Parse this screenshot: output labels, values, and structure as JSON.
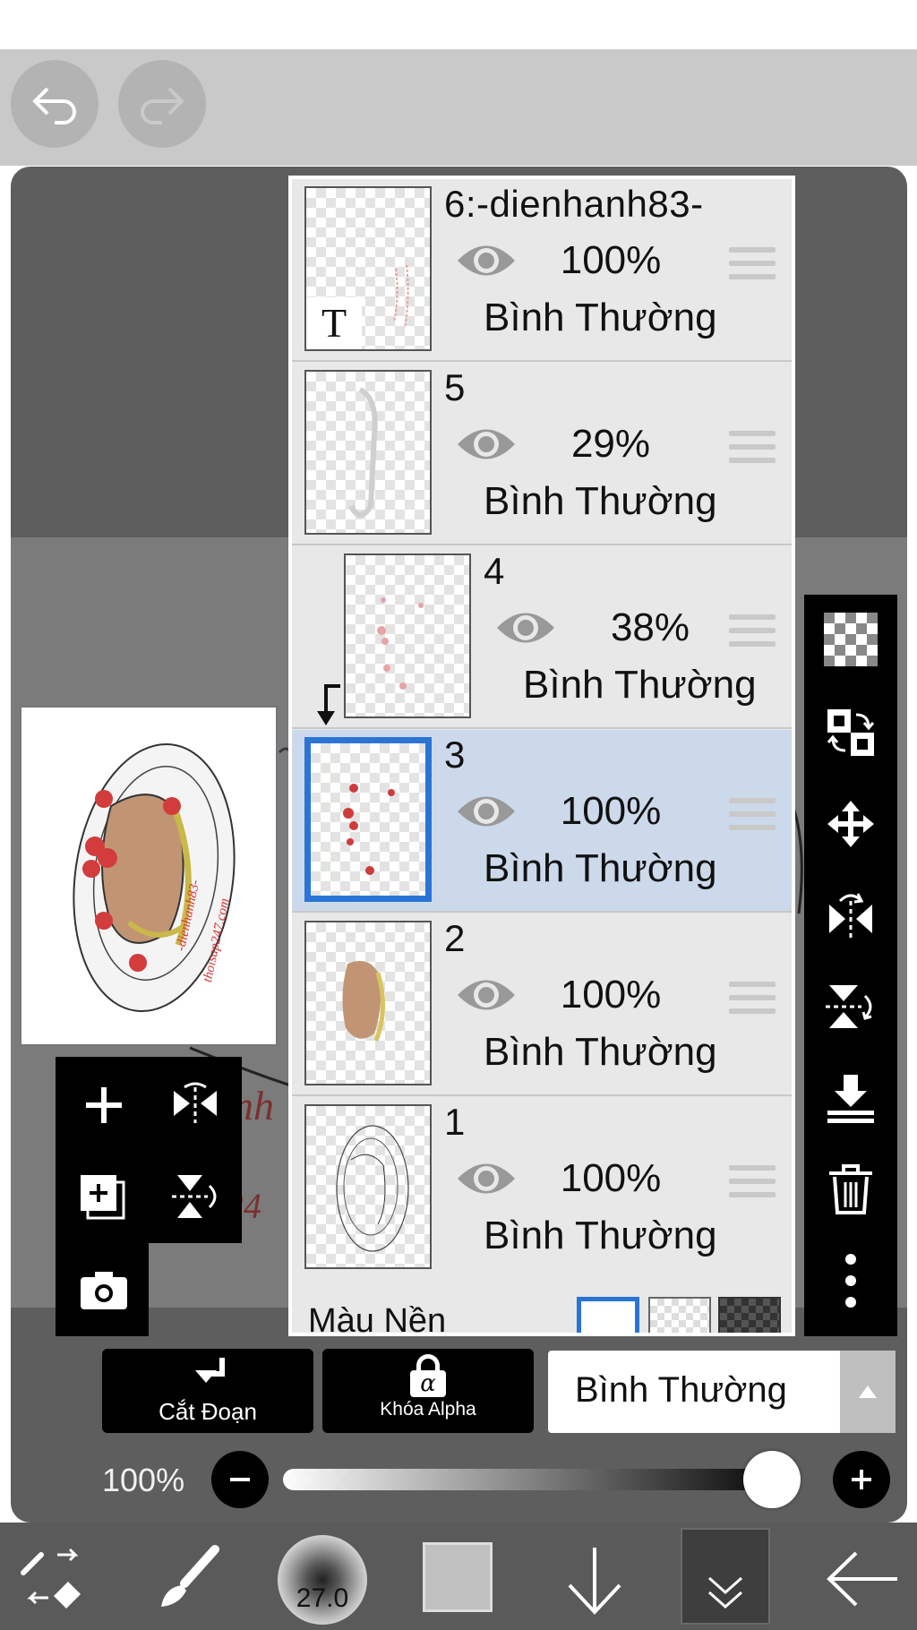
{
  "header": {
    "undo_icon": "undo-icon",
    "redo_icon": "redo-icon"
  },
  "layers": [
    {
      "name": "6:-dienhanh83-",
      "opacity": "100%",
      "mode": "Bình Thường",
      "kind": "text"
    },
    {
      "name": "5",
      "opacity": "29%",
      "mode": "Bình Thường",
      "kind": "raster"
    },
    {
      "name": "4",
      "opacity": "38%",
      "mode": "Bình Thường",
      "kind": "clipped"
    },
    {
      "name": "3",
      "opacity": "100%",
      "mode": "Bình Thường",
      "kind": "raster",
      "selected": true
    },
    {
      "name": "2",
      "opacity": "100%",
      "mode": "Bình Thường",
      "kind": "raster"
    },
    {
      "name": "1",
      "opacity": "100%",
      "mode": "Bình Thường",
      "kind": "raster"
    }
  ],
  "layer_panel": {
    "background_label": "Màu Nền",
    "text_layer_glyph": "T"
  },
  "preview": {
    "watermark_1": "-dienhanh83-",
    "watermark_2": "thoisap247.com"
  },
  "controls": {
    "clip_label": "Cắt Đoạn",
    "alpha_lock_label": "Khóa Alpha",
    "alpha_lock_glyph": "α",
    "blend_mode": "Bình Thường",
    "opacity_label": "100%",
    "opacity_fraction": 1.0
  },
  "toolbar": {
    "brush_size": "27.0"
  },
  "colors": {
    "selection_blue": "#2a74d6",
    "selected_row": "#ccd9ea",
    "panel_bg": "#e8e8e8"
  }
}
